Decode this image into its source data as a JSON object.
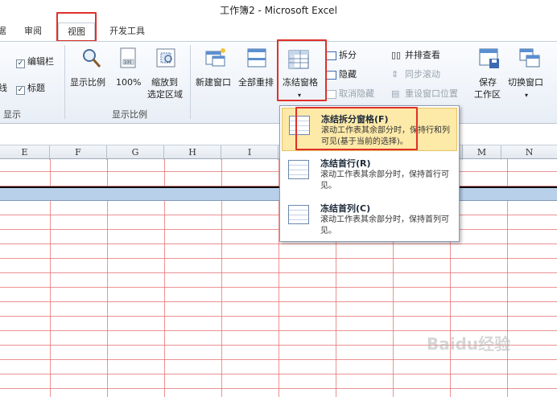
{
  "window": {
    "title": "工作簿2 - Microsoft Excel"
  },
  "tabs": [
    {
      "label": "据"
    },
    {
      "label": "审阅"
    },
    {
      "label": "视图"
    },
    {
      "label": "开发工具"
    }
  ],
  "ribbon": {
    "show": {
      "edit_bar_label": "编辑栏",
      "line_label": "线",
      "title_label": "标题",
      "group_label": "显示"
    },
    "zoom": {
      "zoom_label": "显示比例",
      "zoom100_label": "100%",
      "zoom_sel_line1": "缩放到",
      "zoom_sel_line2": "选定区域",
      "group_label": "显示比例"
    },
    "window": {
      "new_window_label": "新建窗口",
      "arrange_all_label": "全部重排",
      "freeze_panes_label": "冻结窗格",
      "split_label": "拆分",
      "hide_label": "隐藏",
      "unhide_label": "取消隐藏",
      "side_by_side_label": "并排查看",
      "sync_scroll_label": "同步滚动",
      "reset_pos_label": "重设窗口位置",
      "save_ws_line1": "保存",
      "save_ws_line2": "工作区",
      "switch_window_label": "切换窗口"
    }
  },
  "columns": [
    "E",
    "F",
    "G",
    "H",
    "I",
    "M",
    "N"
  ],
  "freeze_menu": {
    "items": [
      {
        "title": "冻结拆分窗格(F)",
        "desc": "滚动工作表其余部分时，保持行和列可见(基于当前的选择)。"
      },
      {
        "title": "冻结首行(R)",
        "desc": "滚动工作表其余部分时，保持首行可见。"
      },
      {
        "title": "冻结首列(C)",
        "desc": "滚动工作表其余部分时，保持首列可见。"
      }
    ]
  },
  "watermark": {
    "text": "Baidu经验"
  },
  "colors": {
    "highlight_box": "#e0302a",
    "menu_hover": "#fde9a8",
    "frozen_row": "#b8d0ea"
  }
}
